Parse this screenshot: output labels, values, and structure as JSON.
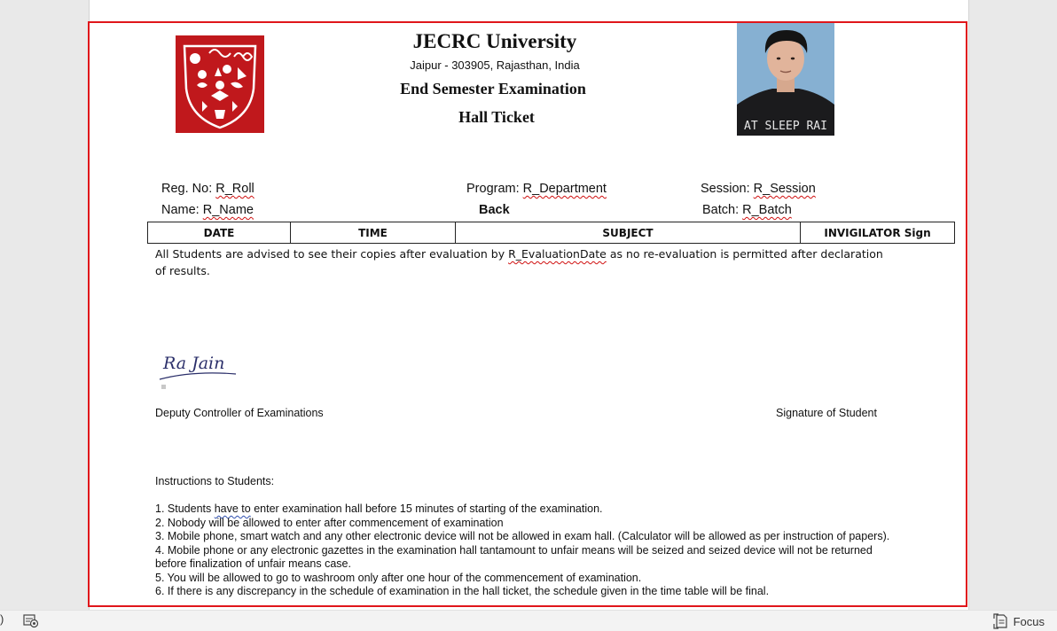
{
  "document": {
    "university_name": "JECRC University",
    "address": "Jaipur - 303905, Rajasthan, India",
    "exam_title": "End Semester Examination",
    "ticket_title": "Hall Ticket",
    "fields": {
      "reg_label": "Reg. No: ",
      "reg_value": "R_Roll",
      "program_label": "Program: ",
      "program_value": "R_Department",
      "session_label": "Session: ",
      "session_value": "R_Session",
      "name_label": "Name: ",
      "name_value": "R_Name",
      "back_label": "Back",
      "batch_label": "Batch: ",
      "batch_value": "R_Batch"
    },
    "schedule_table": {
      "headers": [
        "DATE",
        "TIME",
        "SUBJECT",
        "INVIGILATOR Sign"
      ]
    },
    "advice": {
      "before": "All Students are advised to see their copies after evaluation by ",
      "placeholder": "R_EvaluationDate",
      "after": " as no re-evaluation is permitted after declaration of results."
    },
    "signature_text": "Ra Jain",
    "deputy_label": "Deputy Controller of Examinations",
    "student_sign_label": "Signature of Student",
    "instructions_title": "Instructions to Students:",
    "instructions": {
      "i1_a": "1. Students ",
      "i1_b": "have to",
      "i1_c": " enter examination hall before 15 minutes of starting of the examination.",
      "i2": "2. Nobody will be allowed to enter after commencement of examination",
      "i3": "3. Mobile phone, smart watch and any other electronic device will not be allowed in exam hall. (Calculator will be allowed as per instruction of papers).",
      "i4": "4. Mobile phone or any electronic gazettes in the examination hall tantamount to unfair means will be seized and seized device will not be returned before finalization of unfair means case.",
      "i5": "5. You will be allowed to go to washroom only after one hour of the commencement of examination.",
      "i6": "6. If there is any discrepancy in the schedule of examination in the hall ticket, the schedule given in the time table will be final."
    },
    "photo_shirt_text": "AT SLEEP RAI"
  },
  "statusbar": {
    "left_glyph": ")",
    "focus_label": "Focus"
  },
  "colors": {
    "frame_border": "#e0161b",
    "logo_red": "#c0181c",
    "spell_squiggle": "#d01010",
    "grammar_squiggle": "#3050b0"
  }
}
